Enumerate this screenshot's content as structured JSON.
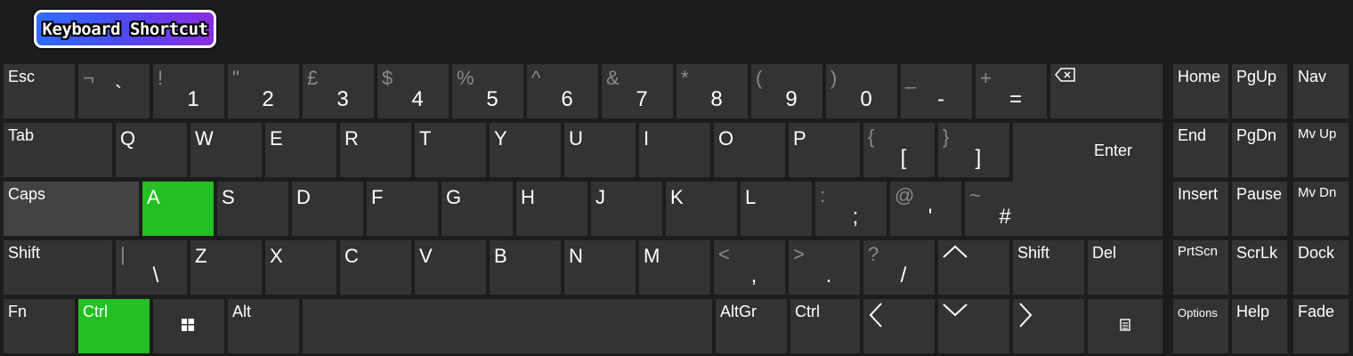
{
  "title": "Keyboard Shortcut",
  "colors": {
    "background": "#1c1c1c",
    "key": "#333333",
    "highlight": "#22c022",
    "secondary_text": "#8a8a8a"
  },
  "highlighted_keys": [
    "A",
    "Ctrl (left)"
  ],
  "keys": {
    "esc": "Esc",
    "grave": {
      "shift": "¬",
      "main": "`"
    },
    "d1": {
      "shift": "!",
      "main": "1"
    },
    "d2": {
      "shift": "\"",
      "main": "2"
    },
    "d3": {
      "shift": "£",
      "main": "3"
    },
    "d4": {
      "shift": "$",
      "main": "4"
    },
    "d5": {
      "shift": "%",
      "main": "5"
    },
    "d6": {
      "shift": "^",
      "main": "6"
    },
    "d7": {
      "shift": "&",
      "main": "7"
    },
    "d8": {
      "shift": "*",
      "main": "8"
    },
    "d9": {
      "shift": "(",
      "main": "9"
    },
    "d0": {
      "shift": ")",
      "main": "0"
    },
    "minus": {
      "shift": "_",
      "main": "-"
    },
    "equal": {
      "shift": "+",
      "main": "="
    },
    "tab": "Tab",
    "q": "Q",
    "w": "W",
    "e": "E",
    "r": "R",
    "t": "T",
    "y": "Y",
    "u": "U",
    "i": "I",
    "o": "O",
    "p": "P",
    "lbracket": {
      "shift": "{",
      "main": "["
    },
    "rbracket": {
      "shift": "}",
      "main": "]"
    },
    "enter": "Enter",
    "caps": "Caps",
    "a": "A",
    "s": "S",
    "d": "D",
    "f": "F",
    "g": "G",
    "h": "H",
    "j": "J",
    "k": "K",
    "l": "L",
    "semicolon": {
      "shift": ":",
      "main": ";"
    },
    "quote": {
      "shift": "@",
      "main": "'"
    },
    "hash": {
      "shift": "~",
      "main": "#"
    },
    "lshift": "Shift",
    "backslash": {
      "shift": "|",
      "main": "\\"
    },
    "z": "Z",
    "x": "X",
    "c": "C",
    "v": "V",
    "b": "B",
    "n": "N",
    "m": "M",
    "comma": {
      "shift": "<",
      "main": ","
    },
    "period": {
      "shift": ">",
      "main": "."
    },
    "slash": {
      "shift": "?",
      "main": "/"
    },
    "rshift": "Shift",
    "del": "Del",
    "fn": "Fn",
    "lctrl": "Ctrl",
    "alt": "Alt",
    "altgr": "AltGr",
    "rctrl": "Ctrl"
  },
  "nav_keys": {
    "home": "Home",
    "pgup": "PgUp",
    "nav": "Nav",
    "end": "End",
    "pgdn": "PgDn",
    "mvup": "Mv Up",
    "insert": "Insert",
    "pause": "Pause",
    "mvdn": "Mv Dn",
    "prtscn": "PrtScn",
    "scrlk": "ScrLk",
    "dock": "Dock",
    "options": "Options",
    "help": "Help",
    "fade": "Fade"
  }
}
